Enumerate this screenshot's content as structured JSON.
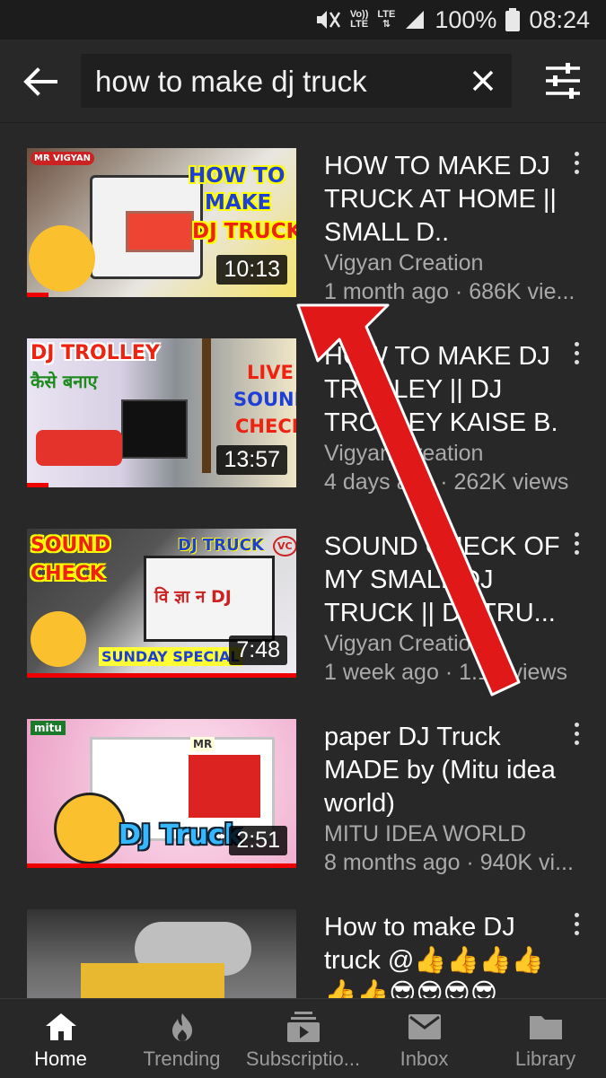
{
  "status_bar": {
    "volte_top": "Vo))",
    "volte_bottom": "LTE",
    "lte_label": "LTE",
    "battery": "100%",
    "time": "08:24"
  },
  "search": {
    "query": "how to make dj truck"
  },
  "results": [
    {
      "title": "HOW TO MAKE DJ TRUCK AT HOME || SMALL D..",
      "channel": "Vigyan Creation",
      "meta": "1 month ago · 686K vie...",
      "duration": "10:13",
      "progress": 0.08,
      "thumb_text": [
        "HOW TO",
        "MAKE",
        "DJ TRUCK",
        "MR VIGYAN"
      ]
    },
    {
      "title": "HOW TO MAKE DJ TROLLEY || DJ TROLLEY KAISE B.",
      "channel": "Vigyan Creation",
      "meta": "4 days ago · 262K views",
      "duration": "13:57",
      "progress": 0.08,
      "thumb_text": [
        "DJ TROLLEY",
        "कैसे बनाए",
        "LIVE",
        "SOUND",
        "CHECK"
      ]
    },
    {
      "title": "SOUND CHECK OF MY SMALL DJ TRUCK || DJ TRU...",
      "channel": "Vigyan Creation",
      "meta": "1 week ago · 1.1K views",
      "duration": "7:48",
      "progress": 1.0,
      "thumb_text": [
        "SOUND",
        "CHECK",
        "DJ TRUCK",
        "VC",
        "वि ज्ञा न DJ",
        "SUNDAY SPECIAL"
      ]
    },
    {
      "title": "paper DJ Truck MADE by (Mitu idea world)",
      "channel": "MITU IDEA WORLD",
      "meta": "8 months ago · 940K vi...",
      "duration": "2:51",
      "progress": 1.0,
      "thumb_text": [
        "mitu",
        "MR",
        "DJ Truck"
      ]
    },
    {
      "title": "How to make DJ truck @👍👍👍👍👍👍😎😎😎😎",
      "channel": "",
      "meta": "",
      "duration": "",
      "progress": 0,
      "thumb_text": []
    }
  ],
  "nav": [
    {
      "label": "Home",
      "icon": "home-icon",
      "active": true
    },
    {
      "label": "Trending",
      "icon": "flame-icon",
      "active": false
    },
    {
      "label": "Subscriptio...",
      "icon": "subscriptions-icon",
      "active": false
    },
    {
      "label": "Inbox",
      "icon": "inbox-icon",
      "active": false
    },
    {
      "label": "Library",
      "icon": "folder-icon",
      "active": false
    }
  ],
  "colors": {
    "background": "#282828",
    "status_bar": "#1c1c1c",
    "progress": "#ee0000",
    "secondary_text": "#aaaaaa",
    "annotation_arrow": "#e01818"
  }
}
